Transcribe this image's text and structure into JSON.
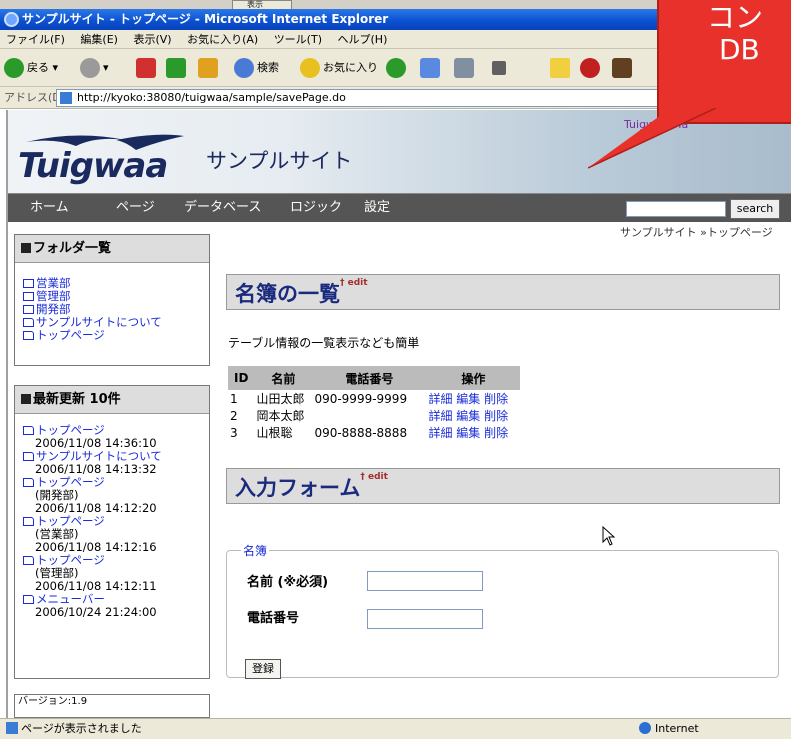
{
  "bg_tab": "表示",
  "window": {
    "title": "サンプルサイト - トップページ - Microsoft Internet Explorer",
    "menu": [
      "ファイル(F)",
      "編集(E)",
      "表示(V)",
      "お気に入り(A)",
      "ツール(T)",
      "ヘルプ(H)"
    ],
    "toolbar": {
      "back": "戻る",
      "search": "検索",
      "favorites": "お気に入り"
    },
    "address_label": "アドレス(D)",
    "address": "http://kyoko:38080/tuigwaa/sample/savePage.do"
  },
  "header": {
    "logo": "Tuigwaa",
    "site_name": "サンプルサイト",
    "manual_link": "Tuigwaa Ma"
  },
  "nav": {
    "items": [
      "ホーム",
      "ページ",
      "データベース",
      "ロジック",
      "設定"
    ],
    "search_label": "search"
  },
  "breadcrumb": "サンプルサイト »トップページ",
  "sidebar": {
    "folders_title": "フォルダ一覧",
    "folders": [
      "営業部",
      "管理部",
      "開発部",
      "サンプルサイトについて",
      "トップページ"
    ],
    "recent_title": "最新更新 10件",
    "recent": [
      {
        "label": "トップページ",
        "sub": "",
        "date": "2006/11/08 14:36:10"
      },
      {
        "label": "サンプルサイトについて",
        "sub": "",
        "date": "2006/11/08 14:13:32"
      },
      {
        "label": "トップページ",
        "sub": "(開発部)",
        "date": "2006/11/08 14:12:20"
      },
      {
        "label": "トップページ",
        "sub": "(営業部)",
        "date": "2006/11/08 14:12:16"
      },
      {
        "label": "トップページ",
        "sub": "(管理部)",
        "date": "2006/11/08 14:12:11"
      },
      {
        "label": "メニューバー",
        "sub": "",
        "date": "2006/10/24 21:24:00"
      }
    ],
    "version": "バージョン:1.9"
  },
  "main": {
    "list_title": "名簿の一覧",
    "edit_mark": "† edit",
    "intro": "テーブル情報の一覧表示なども簡単",
    "table_headers": [
      "ID",
      "名前",
      "電話番号",
      "操作"
    ],
    "table_rows": [
      {
        "id": "1",
        "name": "山田太郎",
        "phone": "090-9999-9999"
      },
      {
        "id": "2",
        "name": "岡本太郎",
        "phone": ""
      },
      {
        "id": "3",
        "name": "山根聡",
        "phone": "090-8888-8888"
      }
    ],
    "actions": [
      "詳細",
      "編集",
      "削除"
    ],
    "form_title": "入力フォーム",
    "fieldset_legend": "名簿",
    "name_label": "名前 (※必須)",
    "phone_label": "電話番号",
    "submit_label": "登録"
  },
  "callout": {
    "line1": "コン",
    "line2": "DB"
  },
  "status": {
    "text": "ページが表示されました",
    "zone": "Internet"
  }
}
